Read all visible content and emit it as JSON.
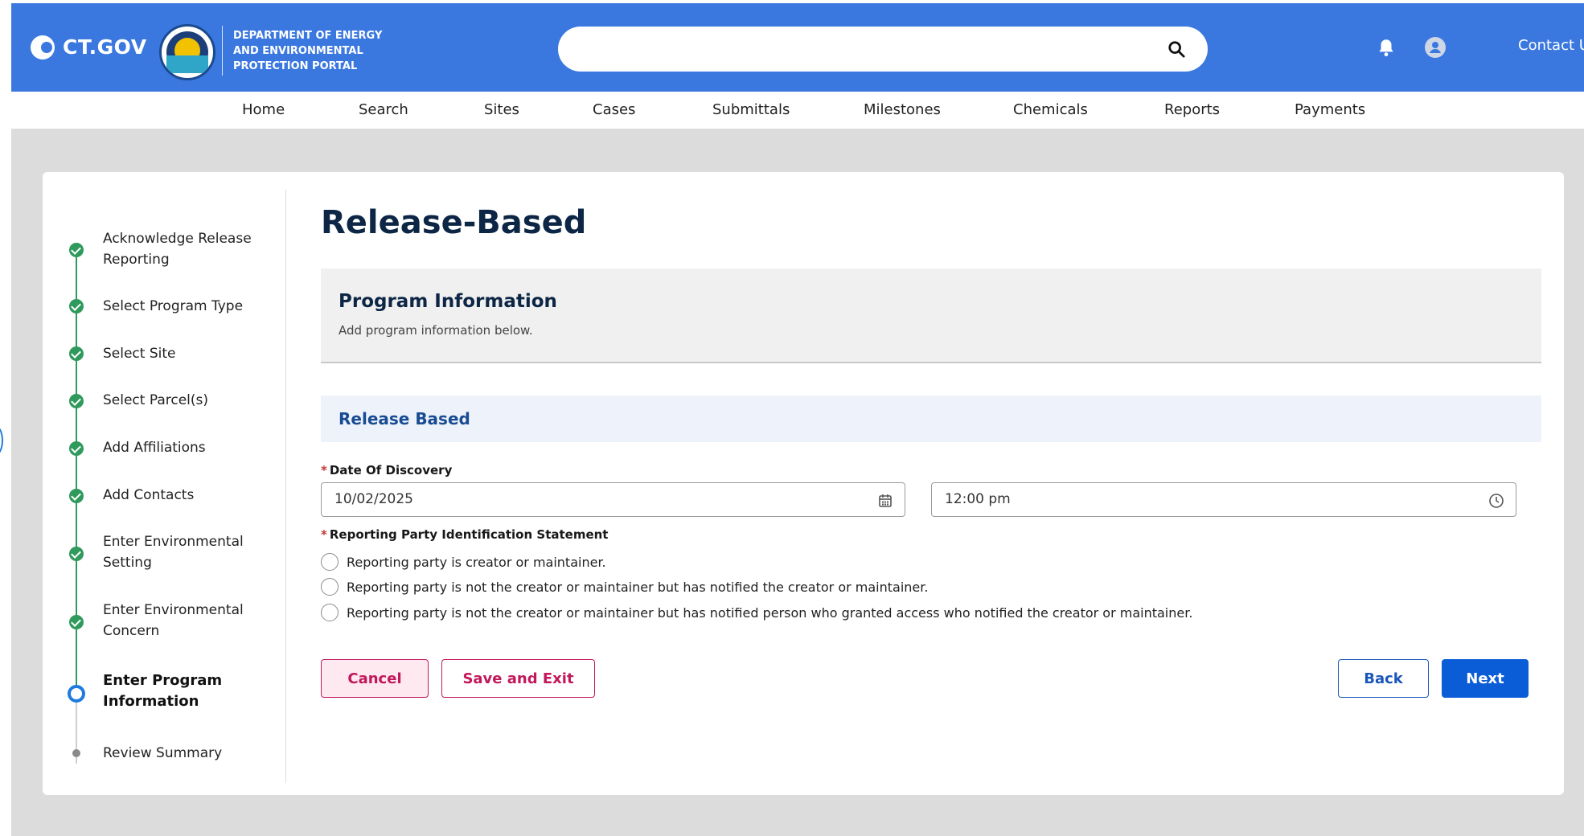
{
  "header": {
    "brand": "CT.GOV",
    "department_lines": [
      "DEPARTMENT OF ENERGY",
      "AND ENVIRONMENTAL",
      "PROTECTION PORTAL"
    ],
    "search_value": "",
    "contact_label": "Contact Us",
    "brand_color": "#3a78e0"
  },
  "nav": {
    "items": [
      "Home",
      "Search",
      "Sites",
      "Cases",
      "Submittals",
      "Milestones",
      "Chemicals",
      "Reports",
      "Payments"
    ]
  },
  "steps": {
    "items": [
      {
        "label": "Acknowledge Release Reporting",
        "state": "complete"
      },
      {
        "label": "Select Program Type",
        "state": "complete"
      },
      {
        "label": "Select Site",
        "state": "complete"
      },
      {
        "label": "Select Parcel(s)",
        "state": "complete"
      },
      {
        "label": "Add Affiliations",
        "state": "complete"
      },
      {
        "label": "Add Contacts",
        "state": "complete"
      },
      {
        "label": "Enter Environmental Setting",
        "state": "complete"
      },
      {
        "label": "Enter Environmental Concern",
        "state": "complete"
      },
      {
        "label": "Enter Program Information",
        "state": "current"
      },
      {
        "label": "Review Summary",
        "state": "pending"
      }
    ]
  },
  "main": {
    "title": "Release-Based",
    "panel_title": "Program Information",
    "panel_subtitle": "Add program information below.",
    "section_title": "Release Based",
    "date_label": "Date Of Discovery",
    "date_value": "10/02/2025",
    "time_value": "12:00 pm",
    "statement_label": "Reporting Party Identification Statement",
    "radio_options": [
      "Reporting party is creator or maintainer.",
      "Reporting party is not the creator or maintainer but has notified the creator or maintainer.",
      "Reporting party is not the creator or maintainer but has notified person who granted access who notified the creator or maintainer."
    ],
    "required_marker": "*"
  },
  "actions": {
    "cancel": "Cancel",
    "save_exit": "Save and Exit",
    "back": "Back",
    "next": "Next"
  }
}
